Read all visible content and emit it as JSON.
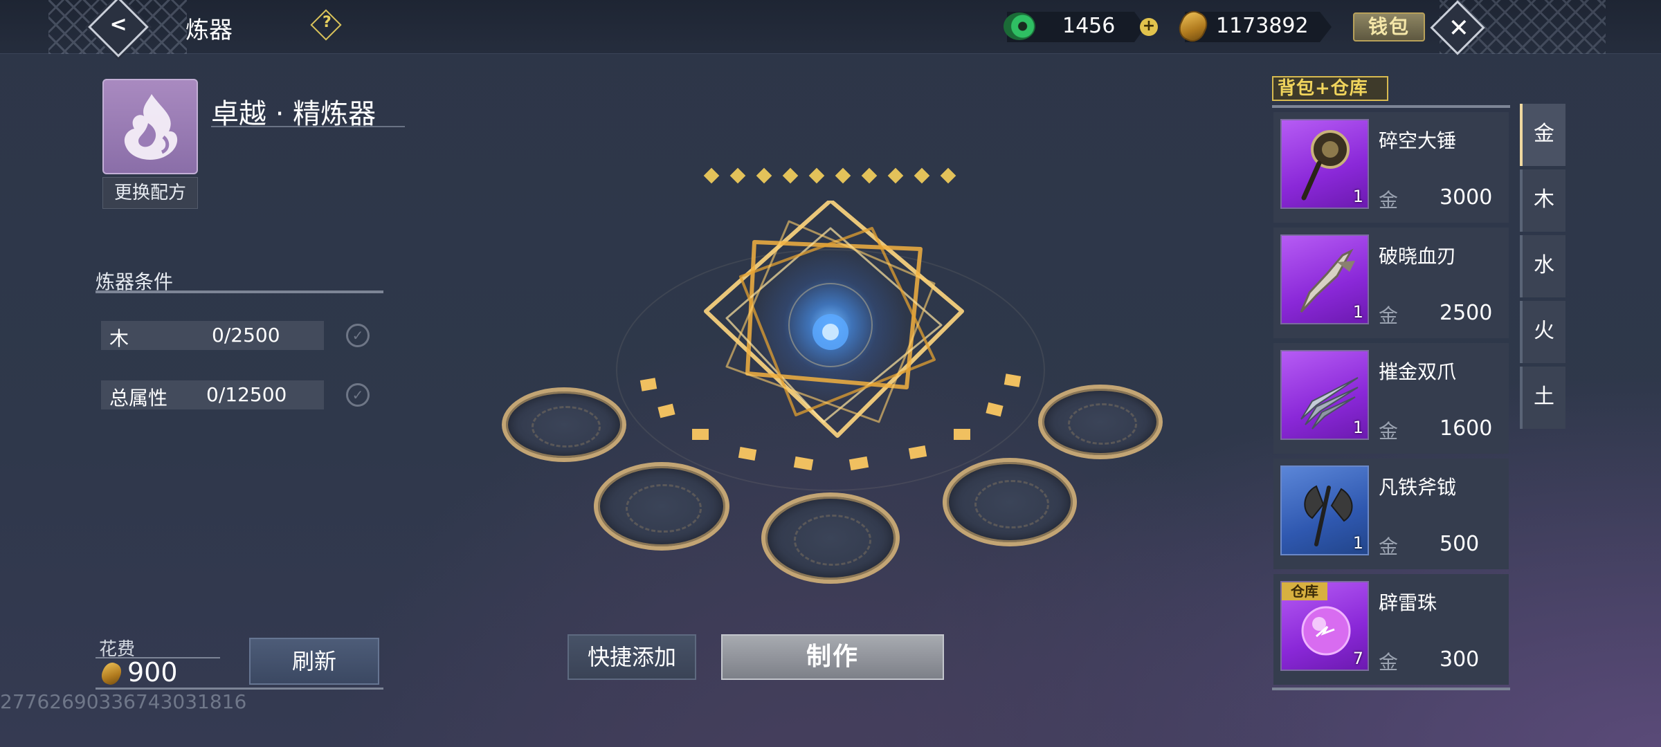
{
  "header": {
    "title": "炼器",
    "jade_amount": "1456",
    "coin_amount": "1173892",
    "wallet_label": "钱包"
  },
  "recipe": {
    "name": "卓越 · 精炼器",
    "change_label": "更换配方"
  },
  "conditions": {
    "title": "炼器条件",
    "rows": [
      {
        "label": "木",
        "value": "0/2500"
      },
      {
        "label": "总属性",
        "value": "0/12500"
      }
    ]
  },
  "cost": {
    "label": "花费",
    "amount": "900",
    "refresh_label": "刷新"
  },
  "watermark": "2776269033674303181​6",
  "actions": {
    "quick_add_label": "快捷添加",
    "make_label": "制作"
  },
  "inventory": {
    "title": "背包+仓库",
    "items": [
      {
        "name": "碎空大锤",
        "qty": "1",
        "attr": "金",
        "value": "3000",
        "rarity": "purple"
      },
      {
        "name": "破晓血刃",
        "qty": "1",
        "attr": "金",
        "value": "2500",
        "rarity": "purple"
      },
      {
        "name": "摧金双爪",
        "qty": "1",
        "attr": "金",
        "value": "1600",
        "rarity": "purple"
      },
      {
        "name": "凡铁斧钺",
        "qty": "1",
        "attr": "金",
        "value": "500",
        "rarity": "blue"
      },
      {
        "name": "辟雷珠",
        "qty": "7",
        "attr": "金",
        "value": "300",
        "rarity": "purple",
        "tag": "仓库"
      }
    ]
  },
  "element_tabs": [
    "金",
    "木",
    "水",
    "火",
    "土"
  ],
  "colors": {
    "accent_gold": "#e3c25a",
    "epic_purple": "#8a28d8",
    "rare_blue": "#2f58b0"
  }
}
